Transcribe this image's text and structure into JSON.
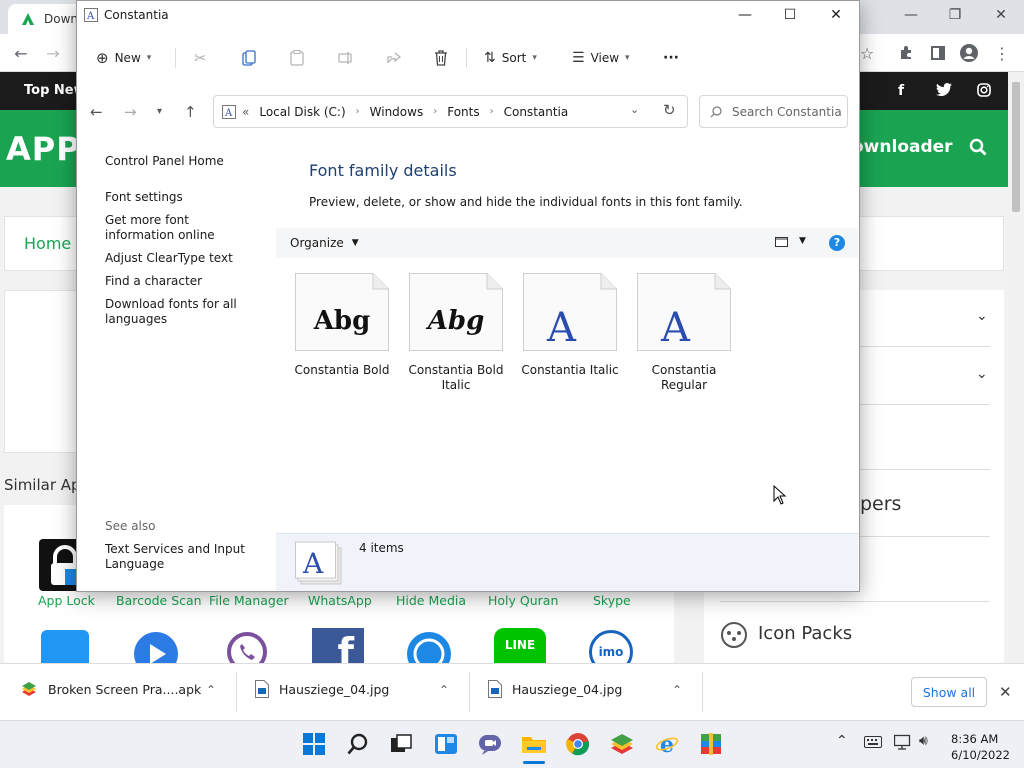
{
  "browser": {
    "tab_title": "Down",
    "window_controls": {
      "minimize": "—",
      "maximize": "❐",
      "close": "✕"
    }
  },
  "website": {
    "topbar_label": "Top New",
    "social": [
      "f",
      "t",
      "ig"
    ],
    "logo": "APPS",
    "downloader": "ownloader",
    "breadcrumb_home": "Home »",
    "similar_heading": "Similar App",
    "apps": [
      "App Lock",
      "Barcode Scan",
      "File Manager",
      "WhatsApp",
      "Hide Media",
      "Holy Quran",
      "Skype"
    ],
    "right_heading": "pers",
    "icon_packs": "Icon Packs"
  },
  "explorer": {
    "title": "Constantia",
    "toolbar": {
      "new": "New",
      "sort": "Sort",
      "view": "View",
      "more": "···"
    },
    "address": {
      "prefix": "«",
      "path": [
        "Local Disk (C:)",
        "Windows",
        "Fonts",
        "Constantia"
      ]
    },
    "search_placeholder": "Search Constantia",
    "left_pane": {
      "control_panel_home": "Control Panel Home",
      "links": [
        "Font settings",
        "Get more font information online",
        "Adjust ClearType text",
        "Find a character",
        "Download fonts for all languages"
      ],
      "see_also": "See also",
      "see_also_links": [
        "Text Services and Input Language"
      ]
    },
    "heading": "Font family details",
    "subheading": "Preview, delete, or show and hide the individual fonts in this font family.",
    "organize": "Organize",
    "fonts": [
      {
        "preview": "Abg",
        "style": "bold",
        "name": "Constantia Bold"
      },
      {
        "preview": "Abg",
        "style": "bold-italic",
        "name": "Constantia Bold Italic"
      },
      {
        "preview": "A",
        "style": "italic",
        "name": "Constantia Italic"
      },
      {
        "preview": "A",
        "style": "regular",
        "name": "Constantia Regular"
      }
    ],
    "item_count": "4 items"
  },
  "downloads": {
    "items": [
      "Broken Screen Pra....apk",
      "Hausziege_04.jpg",
      "Hausziege_04.jpg"
    ],
    "show_all": "Show all"
  },
  "taskbar": {
    "time": "8:36 AM",
    "date": "6/10/2022"
  },
  "colors": {
    "site_green": "#1aa452",
    "explorer_blue": "#1e3f72",
    "font_glyph_blue": "#2b4db0"
  }
}
